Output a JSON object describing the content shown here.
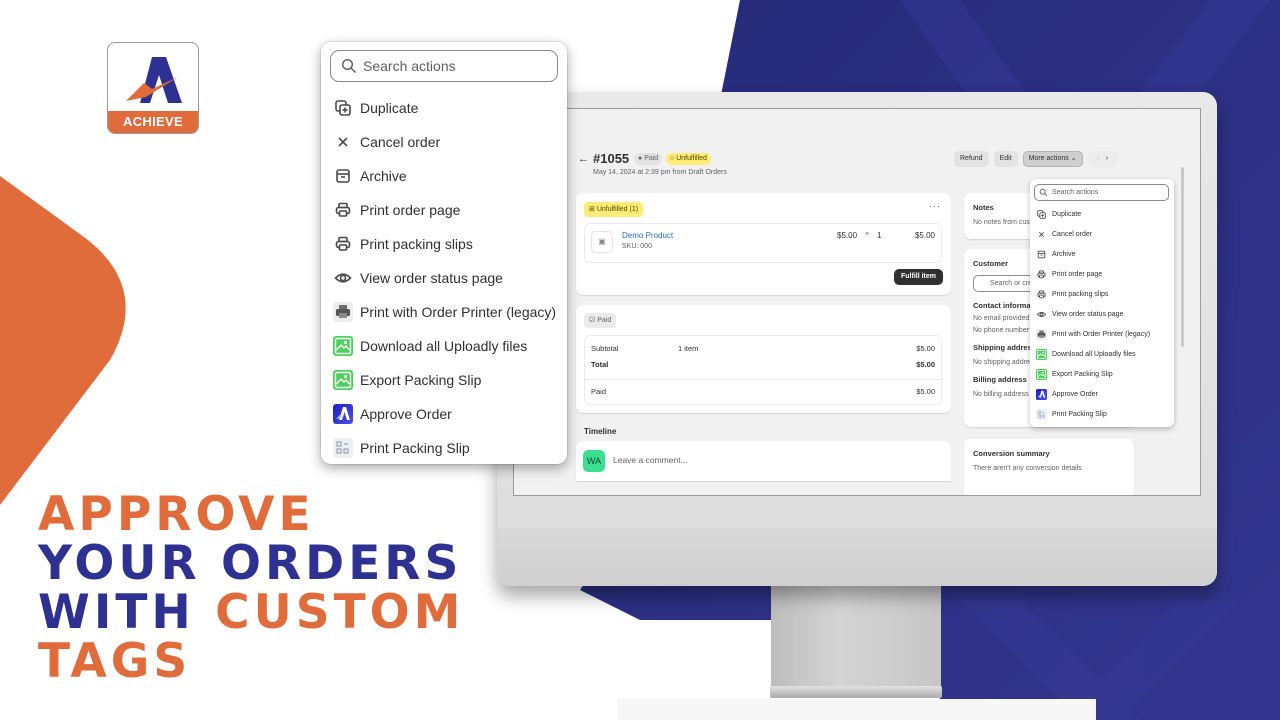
{
  "brand": {
    "logo_text": "ACHIEVE",
    "colors": {
      "orange": "#e06b3b",
      "navy": "#2e3192",
      "background": "#ffffff"
    }
  },
  "headline": {
    "line1": [
      {
        "text": "APPROVE",
        "color": "orange"
      }
    ],
    "line2": [
      {
        "text": "YOUR ORDERS",
        "color": "navy"
      }
    ],
    "line3": [
      {
        "text": "WITH ",
        "color": "navy"
      },
      {
        "text": "CUSTOM",
        "color": "orange"
      }
    ],
    "line4": [
      {
        "text": "TAGS",
        "color": "orange"
      }
    ]
  },
  "actions_menu": {
    "search_placeholder": "Search actions",
    "items": [
      {
        "label": "Duplicate",
        "icon": "duplicate-icon"
      },
      {
        "label": "Cancel order",
        "icon": "close-icon"
      },
      {
        "label": "Archive",
        "icon": "archive-icon"
      },
      {
        "label": "Print order page",
        "icon": "printer-icon"
      },
      {
        "label": "Print packing slips",
        "icon": "printer-icon"
      },
      {
        "label": "View order status page",
        "icon": "eye-icon"
      },
      {
        "label": "Print with Order Printer (legacy)",
        "icon": "order-printer-app-icon"
      },
      {
        "label": "Download all Uploadly files",
        "icon": "uploadly-app-icon"
      },
      {
        "label": "Export Packing Slip",
        "icon": "uploadly-app-icon"
      },
      {
        "label": "Approve Order",
        "icon": "achieve-app-icon"
      },
      {
        "label": "Print Packing Slip",
        "icon": "packing-slip-app-icon"
      }
    ]
  },
  "order": {
    "back_label": "←",
    "number": "#1055",
    "payment_badge": "Paid",
    "fulfillment_badge": "Unfulfilled",
    "date_line": "May 14, 2024 at 2:39 pm from Draft Orders",
    "header_buttons": {
      "refund": "Refund",
      "edit": "Edit",
      "more_actions": "More actions ⌄",
      "prev": "‹",
      "next": "›"
    },
    "unfulfilled_card": {
      "tag": "Unfulfilled (1)",
      "menu": "···",
      "product_name": "Demo Product",
      "sku": "SKU: 000",
      "unit_price": "$5.00",
      "times": "×",
      "quantity": "1",
      "line_total": "$5.00",
      "fulfill_button": "Fulfill item"
    },
    "payment_card": {
      "tag": "Paid",
      "rows": [
        {
          "label": "Subtotal",
          "middle": "1 item",
          "value": "$5.00",
          "bold": false
        },
        {
          "label": "Total",
          "middle": "",
          "value": "$5.00",
          "bold": true
        },
        {
          "label": "Paid",
          "middle": "",
          "value": "$5.00",
          "bold": false
        }
      ]
    },
    "timeline": {
      "title": "Timeline",
      "avatar_initials": "WA",
      "comment_placeholder": "Leave a comment..."
    },
    "sidebar": {
      "notes_title": "Notes",
      "notes_text": "No notes from customer",
      "customer_title": "Customer",
      "customer_search_placeholder": "Search or create a customer",
      "contact_title": "Contact information",
      "contact_email": "No email provided",
      "contact_phone": "No phone number",
      "shipping_title": "Shipping address",
      "shipping_text": "No shipping address provided",
      "billing_title": "Billing address",
      "billing_text": "No billing address provided",
      "conversion_title": "Conversion summary",
      "conversion_text": "There aren't any conversion details"
    }
  }
}
